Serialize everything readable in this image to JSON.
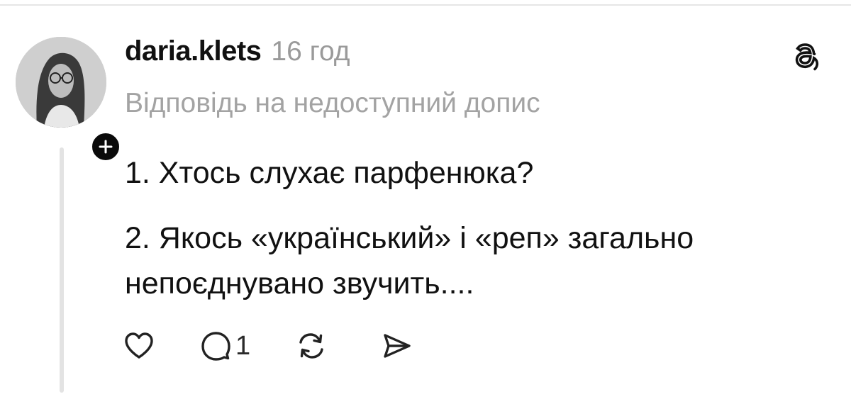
{
  "post": {
    "username": "daria.klets",
    "time_ago": "16 год",
    "reply_context": "Відповідь на недоступний допис",
    "lines": [
      "1. Хтось слухає парфенюка?",
      "2. Якось «український» і «реп» загально",
      "непоєднувано звучить...."
    ]
  },
  "actions": {
    "like_icon": "heart-icon",
    "reply_icon": "comment-icon",
    "reply_count": "1",
    "repost_icon": "repost-icon",
    "share_icon": "send-icon"
  },
  "icons": {
    "logo": "threads-logo-icon",
    "follow": "plus-icon"
  },
  "colors": {
    "text": "#111111",
    "muted": "#9a9a9a",
    "thread_line": "#e3e3e3",
    "badge": "#0a0a0a"
  }
}
